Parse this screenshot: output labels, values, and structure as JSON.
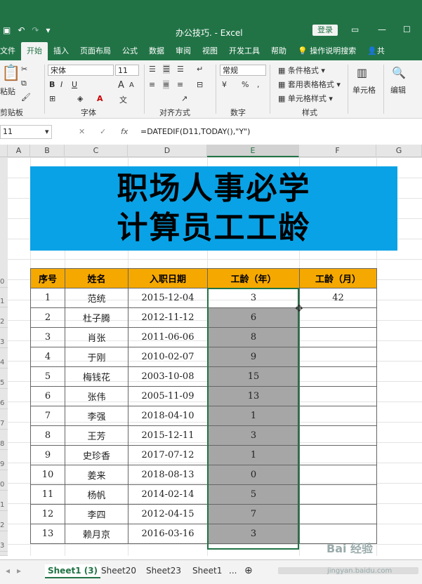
{
  "window": {
    "title": "办公技巧. - Excel",
    "login_label": "登录",
    "minimize": "—",
    "restore": "☐"
  },
  "qat": {
    "save_icon": "save-icon",
    "undo": "↶",
    "redo": "↷",
    "more": "▾"
  },
  "tabs": [
    "文件",
    "开始",
    "插入",
    "页面布局",
    "公式",
    "数据",
    "审阅",
    "视图",
    "开发工具",
    "帮助",
    "操作说明搜索"
  ],
  "share_label": "共",
  "ribbon": {
    "clipboard": {
      "paste": "粘贴",
      "label": "剪贴板"
    },
    "font": {
      "name": "宋体",
      "size": "11",
      "bold": "B",
      "italic": "I",
      "underline": "U",
      "grow": "A",
      "shrink": "A",
      "label": "字体"
    },
    "alignment": {
      "label": "对齐方式"
    },
    "number": {
      "format": "常规",
      "label": "数字",
      "percent": "%"
    },
    "styles": {
      "conditional": "条件格式",
      "table": "套用表格格式",
      "cell": "单元格样式",
      "label": "样式"
    },
    "cells": {
      "label": "单元格"
    },
    "editing": {
      "label": "编辑"
    }
  },
  "formula_bar": {
    "name_box": "11",
    "cancel": "✕",
    "enter": "✓",
    "fx": "fx",
    "formula": "=DATEDIF(D11,TODAY(),\"Y\")"
  },
  "columns": [
    "A",
    "B",
    "C",
    "D",
    "E",
    "F",
    "G"
  ],
  "row_numbers": [
    "0",
    "1",
    "2",
    "3",
    "4",
    "5",
    "6",
    "7",
    "8",
    "9",
    "0",
    "1",
    "2",
    "3"
  ],
  "banner": {
    "line1": "职场人事必学",
    "line2": "计算员工工龄"
  },
  "table": {
    "headers": [
      "序号",
      "姓名",
      "入职日期",
      "工龄（年）",
      "工龄（月）"
    ],
    "rows": [
      [
        "1",
        "范统",
        "2015-12-04",
        "3",
        "42"
      ],
      [
        "2",
        "杜子腾",
        "2012-11-12",
        "6",
        ""
      ],
      [
        "3",
        "肖张",
        "2011-06-06",
        "8",
        ""
      ],
      [
        "4",
        "于刚",
        "2010-02-07",
        "9",
        ""
      ],
      [
        "5",
        "梅钱花",
        "2003-10-08",
        "15",
        ""
      ],
      [
        "6",
        "张伟",
        "2005-11-09",
        "13",
        ""
      ],
      [
        "7",
        "李强",
        "2018-04-10",
        "1",
        ""
      ],
      [
        "8",
        "王芳",
        "2015-12-11",
        "3",
        ""
      ],
      [
        "9",
        "史珍香",
        "2017-07-12",
        "1",
        ""
      ],
      [
        "10",
        "姜来",
        "2018-08-13",
        "0",
        ""
      ],
      [
        "11",
        "杨帆",
        "2014-02-14",
        "5",
        ""
      ],
      [
        "12",
        "李四",
        "2012-04-15",
        "7",
        ""
      ],
      [
        "13",
        "赖月京",
        "2016-03-16",
        "3",
        ""
      ]
    ]
  },
  "sheets": [
    "Sheet1 (3)",
    "Sheet20",
    "Sheet23",
    "Sheet1",
    "..."
  ],
  "add_sheet": "⊕",
  "watermark": {
    "brand": "Bai 经验",
    "url": "jingyan.baidu.com"
  },
  "colors": {
    "excel_green": "#217346",
    "banner_blue": "#0aa2e6",
    "header_orange": "#f5a800",
    "selection_gray": "#a6a6a6"
  }
}
